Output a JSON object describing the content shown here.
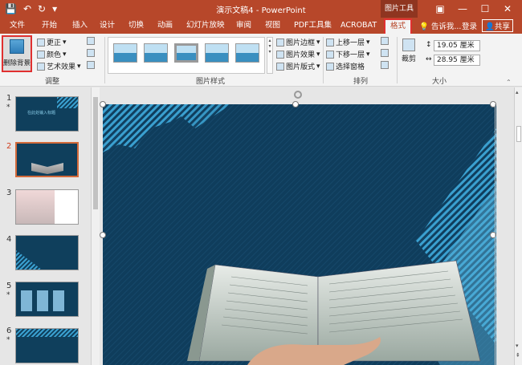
{
  "window": {
    "title": "演示文稿4 - PowerPoint",
    "context_tool_label": "图片工具"
  },
  "tabs": {
    "file": "文件",
    "home": "开始",
    "insert": "插入",
    "design": "设计",
    "transitions": "切换",
    "animations": "动画",
    "slideshow": "幻灯片放映",
    "review": "审阅",
    "view": "视图",
    "pdf": "PDF工具集",
    "acrobat": "ACROBAT",
    "format": "格式",
    "tell_me": "告诉我...",
    "login": "登录",
    "share": "共享"
  },
  "ribbon": {
    "remove_bg": "删除背景",
    "corrections": "更正",
    "color": "颜色",
    "artistic": "艺术效果",
    "adjust_group": "调整",
    "picture_border": "图片边框",
    "picture_effects": "图片效果",
    "picture_layout": "图片版式",
    "styles_group": "图片样式",
    "bring_forward": "上移一层",
    "send_backward": "下移一层",
    "selection_pane": "选择窗格",
    "arrange_group": "排列",
    "crop": "裁剪",
    "height": "19.05 厘米",
    "width": "28.95 厘米",
    "size_group": "大小"
  },
  "slides": [
    {
      "num": "1",
      "star": "*",
      "title": "在此处输入标题"
    },
    {
      "num": "2",
      "star": ""
    },
    {
      "num": "3",
      "star": ""
    },
    {
      "num": "4",
      "star": ""
    },
    {
      "num": "5",
      "star": "*"
    },
    {
      "num": "6",
      "star": "*"
    }
  ],
  "colors": {
    "accent": "#b7472a",
    "slide_bg": "#0f3d5c",
    "stripe": "#3aa0d0"
  }
}
